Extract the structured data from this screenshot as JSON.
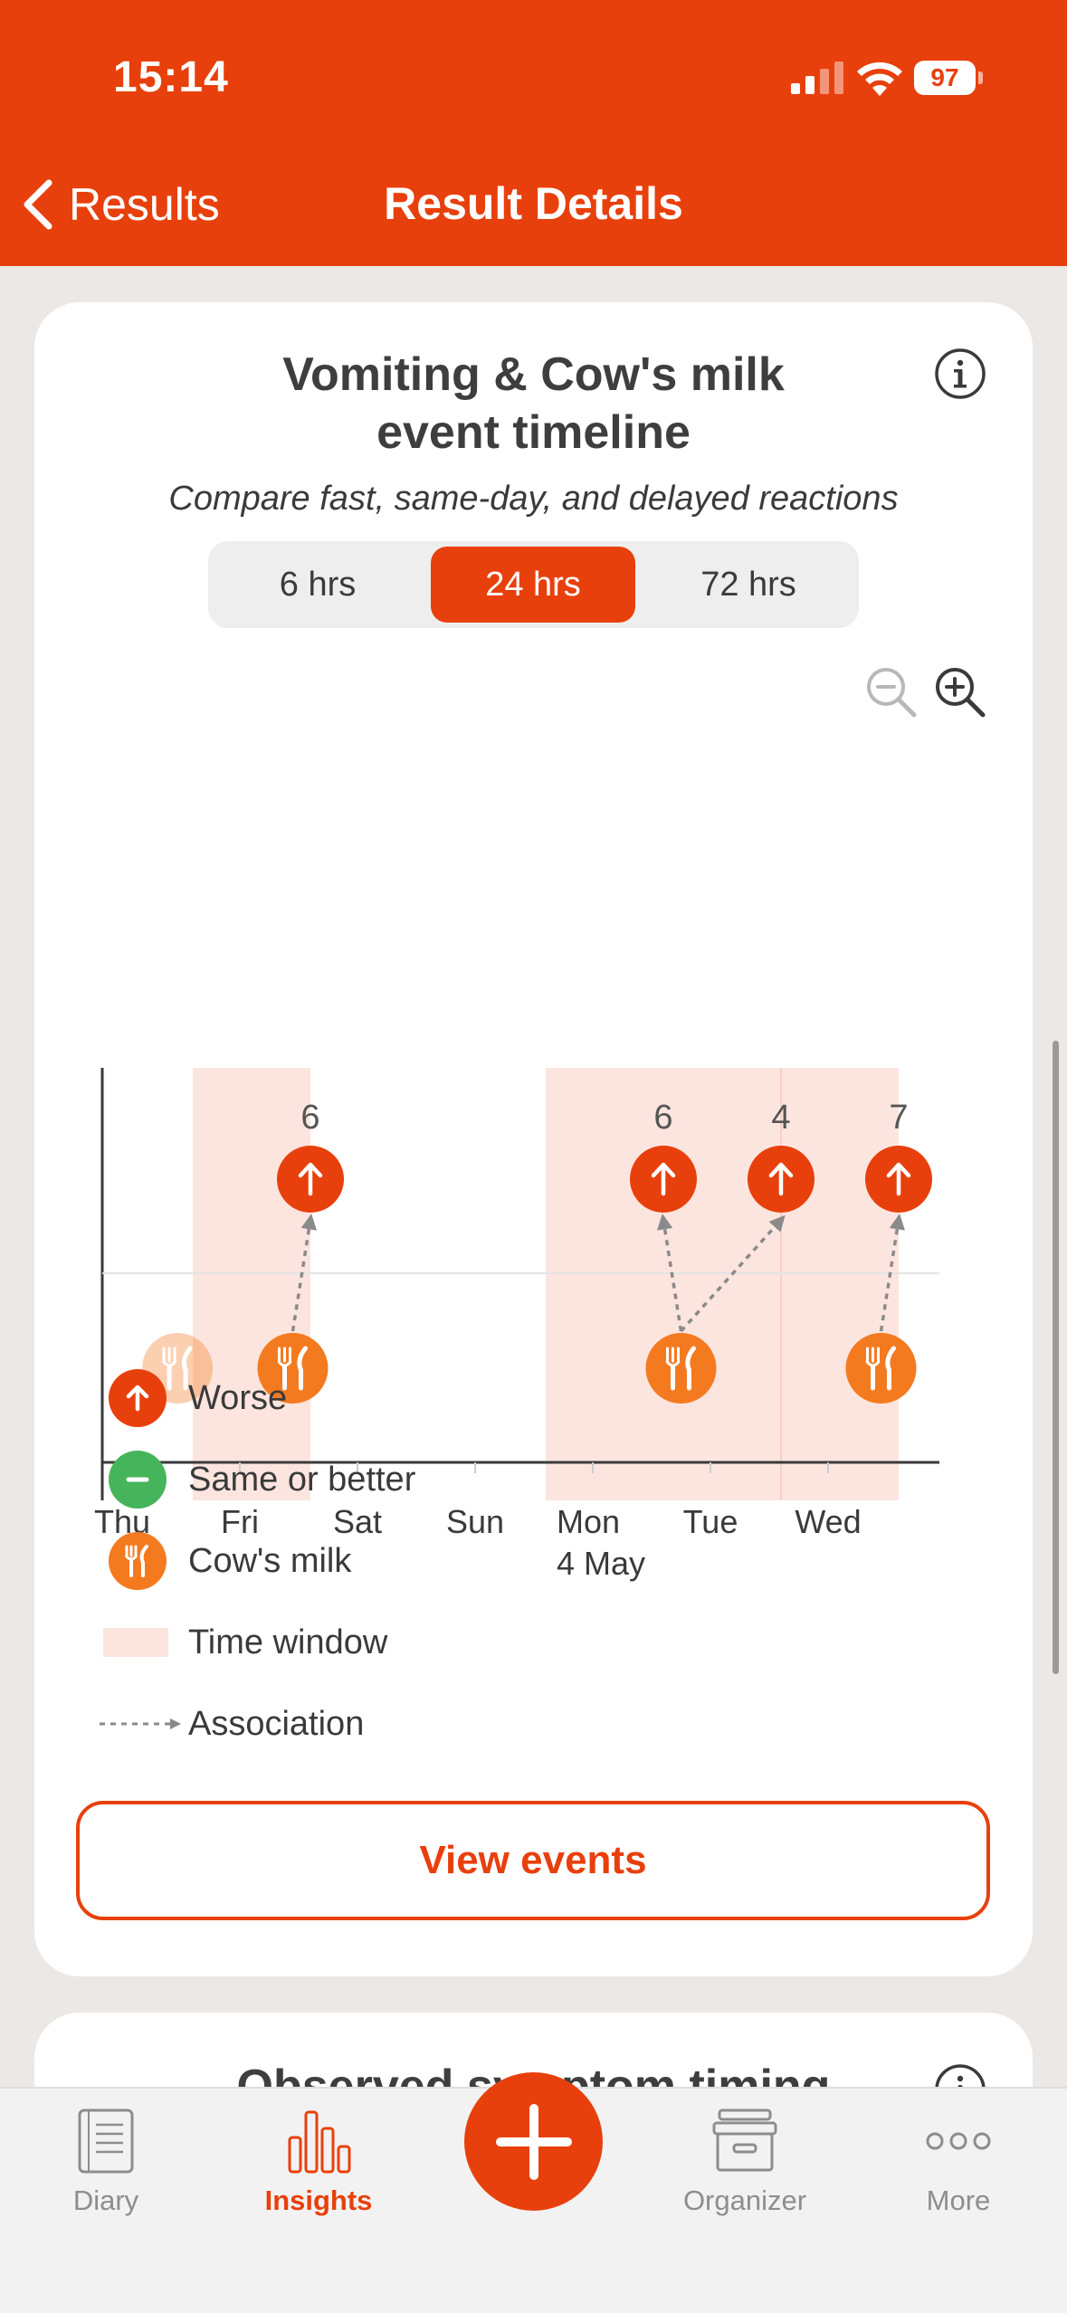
{
  "status_bar": {
    "time": "15:14",
    "battery": "97"
  },
  "nav": {
    "back_label": "Results",
    "title": "Result Details"
  },
  "card": {
    "title_line1": "Vomiting & Cow's milk",
    "title_line2": "event timeline",
    "subtitle": "Compare fast, same-day, and delayed reactions",
    "ranges": [
      {
        "label": "6 hrs",
        "selected": false
      },
      {
        "label": "24 hrs",
        "selected": true
      },
      {
        "label": "72 hrs",
        "selected": false
      }
    ]
  },
  "chart_data": {
    "type": "scatter",
    "x_labels": [
      "Thu",
      "Fri",
      "Sat",
      "Sun",
      "Mon",
      "Tue",
      "Wed"
    ],
    "x_sublabels": [
      "",
      "",
      "",
      "",
      "4 May",
      "",
      ""
    ],
    "time_windows": [
      {
        "start": 0.6,
        "end": 1.6
      },
      {
        "start": 3.6,
        "end": 6.6
      }
    ],
    "exposures": [
      {
        "name": "Cow's milk",
        "day": 0.47,
        "faded": true
      },
      {
        "name": "Cow's milk",
        "day": 1.45,
        "faded": false
      },
      {
        "name": "Cow's milk",
        "day": 4.75,
        "faded": false
      },
      {
        "name": "Cow's milk",
        "day": 6.45,
        "faded": false
      }
    ],
    "symptoms": [
      {
        "name": "Worse",
        "day": 1.6,
        "count": "6"
      },
      {
        "name": "Worse",
        "day": 4.6,
        "count": "6"
      },
      {
        "name": "Worse",
        "day": 5.6,
        "count": "4"
      },
      {
        "name": "Worse",
        "day": 6.6,
        "count": "7"
      }
    ],
    "associations": [
      {
        "from_exposure": 1,
        "to_symptom": 0
      },
      {
        "from_exposure": 2,
        "to_symptom": 1
      },
      {
        "from_exposure": 2,
        "to_symptom": 2
      },
      {
        "from_exposure": 3,
        "to_symptom": 3
      }
    ]
  },
  "legend": {
    "worse": "Worse",
    "same": "Same or better",
    "exposure": "Cow's milk",
    "window": "Time window",
    "association": "Association"
  },
  "actions": {
    "view_events": "View events"
  },
  "card2": {
    "title": "Observed symptom timing"
  },
  "tabs": [
    {
      "label": "Diary",
      "icon": "diary-icon",
      "active": false
    },
    {
      "label": "Insights",
      "icon": "insights-icon",
      "active": true
    },
    {
      "label": "Organizer",
      "icon": "organizer-icon",
      "active": false
    },
    {
      "label": "More",
      "icon": "more-icon",
      "active": false
    }
  ],
  "colors": {
    "brand": "#e8400c",
    "exposure": "#f47a20",
    "same": "#46b45a",
    "window": "#fde5df"
  }
}
